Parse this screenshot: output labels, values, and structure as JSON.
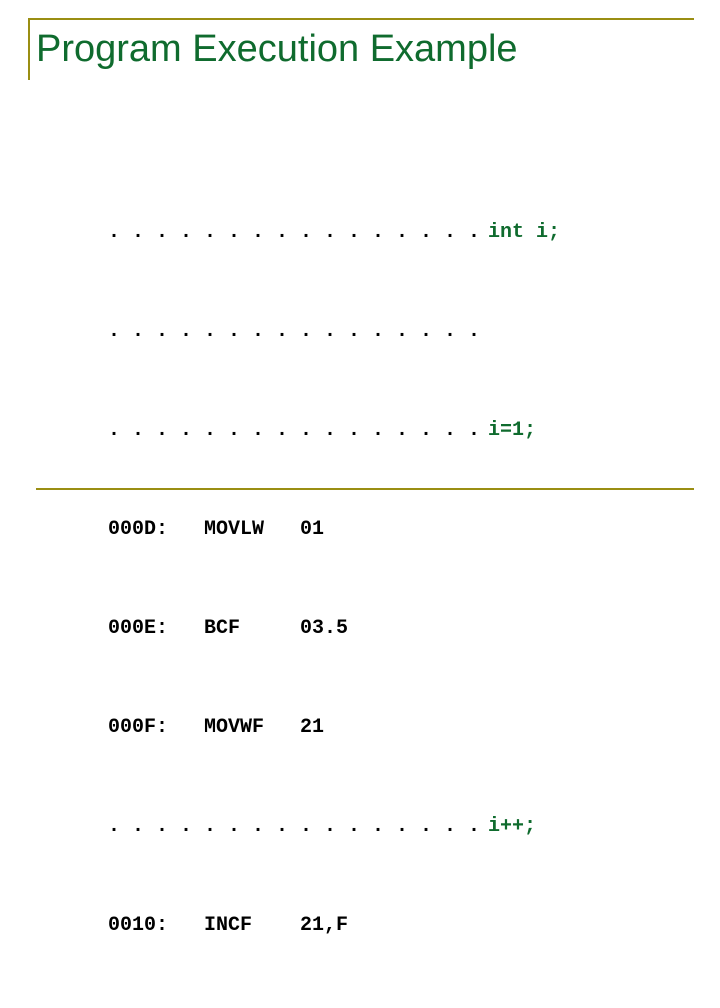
{
  "slide": {
    "title": "Program Execution Example",
    "accent_color": "#9a8e13",
    "title_color": "#0f6b2e",
    "code_color": "#000000",
    "c_color": "#0f6b2e",
    "asm_lines": [
      ". . . . . . . . . . . . . . . .",
      ". . . . . . . . . . . . . . . .",
      ". . . . . . . . . . . . . . . .",
      "000D:   MOVLW   01",
      "000E:   BCF     03.5",
      "000F:   MOVWF   21",
      ". . . . . . . . . . . . . . . .",
      "0010:   INCF    21,F"
    ],
    "c_lines": [
      "int i;",
      "",
      "i=1;",
      "",
      "",
      "",
      "i++;",
      ""
    ]
  }
}
